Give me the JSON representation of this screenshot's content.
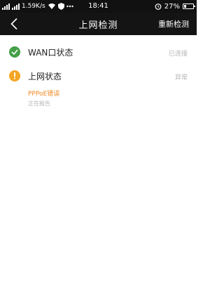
{
  "status_bar": {
    "network_speed": "1.59K/s",
    "time": "18:41",
    "battery": "27%"
  },
  "navbar": {
    "title": "上网检测",
    "action_label": "重新检测"
  },
  "items": [
    {
      "label": "WAN口状态",
      "status": "已连接",
      "icon": "check-circle-icon"
    },
    {
      "label": "上网状态",
      "status": "异常",
      "icon": "warning-circle-icon"
    }
  ],
  "detail": {
    "error": "PPPoE错误",
    "sub": "正在报告"
  },
  "colors": {
    "ok": "#43a047",
    "warn": "#f5a623",
    "error_text": "#f08a24"
  }
}
